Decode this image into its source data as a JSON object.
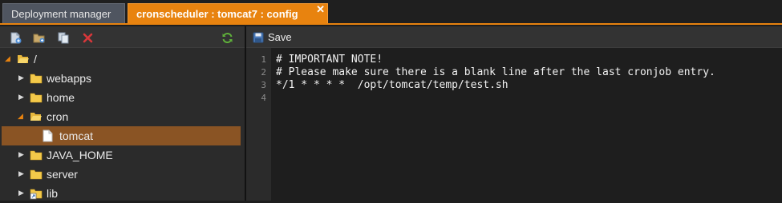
{
  "tabs": {
    "deployment_manager": "Deployment manager",
    "config": "cronscheduler : tomcat7 : config",
    "close_glyph": "✕"
  },
  "left_toolbar": {
    "icons": [
      "new-file-icon",
      "new-folder-icon",
      "copy-icon",
      "delete-icon",
      "refresh-icon"
    ]
  },
  "tree": {
    "items": [
      {
        "label": "/",
        "icon": "folder-open-icon",
        "expanded": true
      },
      {
        "label": "webapps",
        "icon": "folder-icon",
        "expanded": false
      },
      {
        "label": "home",
        "icon": "folder-icon",
        "expanded": false
      },
      {
        "label": "cron",
        "icon": "folder-open-icon",
        "expanded": true
      },
      {
        "label": "tomcat",
        "icon": "file-icon",
        "selected": true
      },
      {
        "label": "JAVA_HOME",
        "icon": "folder-icon",
        "expanded": false
      },
      {
        "label": "server",
        "icon": "folder-icon",
        "expanded": false
      },
      {
        "label": "lib",
        "icon": "folder-link-icon",
        "expanded": false
      }
    ]
  },
  "editor_toolbar": {
    "save_label": "Save"
  },
  "editor": {
    "line_numbers": [
      "1",
      "2",
      "3",
      "4"
    ],
    "lines": [
      "# IMPORTANT NOTE!",
      "# Please make sure there is a blank line after the last cronjob entry.",
      "*/1 * * * *  /opt/tomcat/temp/test.sh",
      ""
    ]
  },
  "colors": {
    "accent": "#e8830f",
    "selection": "#8a5424",
    "folder": "#f3c94a"
  }
}
